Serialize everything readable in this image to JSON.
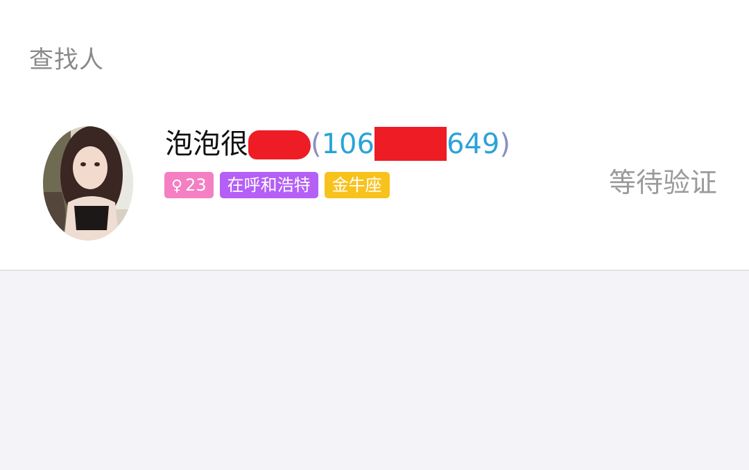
{
  "section": {
    "title": "查找人"
  },
  "result": {
    "avatar_icon": "user-photo",
    "name_prefix": "泡泡很",
    "id_open_paren": "(",
    "id_prefix": "106",
    "id_suffix": "649",
    "id_close_paren": ")",
    "tags": {
      "gender_icon": "♀",
      "age": "23",
      "city": "在呼和浩特",
      "zodiac": "金牛座"
    },
    "status": "等待验证"
  },
  "colors": {
    "qq_number": "#2aa3d8",
    "gender_tag": "#f47fc3",
    "city_tag": "#b45ff5",
    "zodiac_tag": "#f8c21d",
    "redaction": "#ee1c24"
  }
}
